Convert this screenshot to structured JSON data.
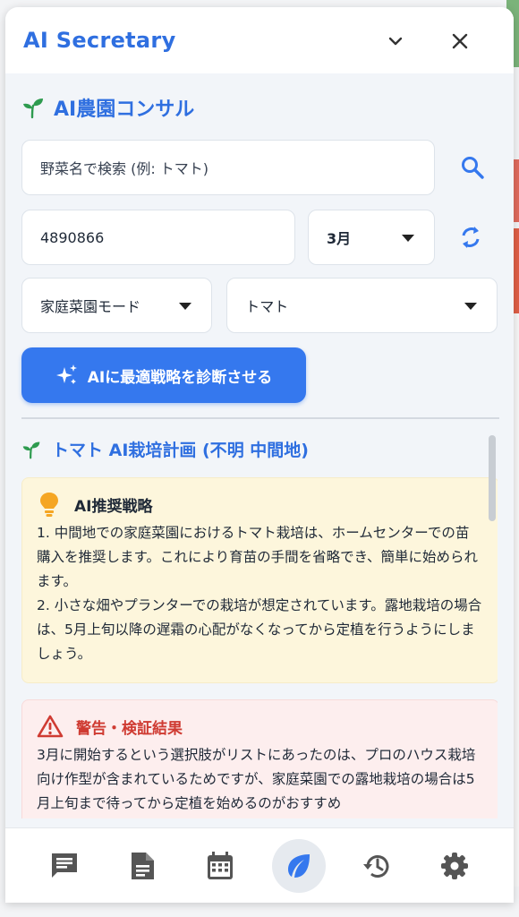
{
  "header": {
    "title": "AI Secretary"
  },
  "consult": {
    "title": "AI農園コンサル",
    "search_placeholder": "野菜名で検索 (例: トマト)",
    "postal_code": "4890866",
    "month": "3月",
    "mode": "家庭菜園モード",
    "crop": "トマト",
    "diagnose_label": "AIに最適戦略を診断させる"
  },
  "plan": {
    "title": "トマト AI栽培計画 (不明 中間地)",
    "strategy": {
      "title": "AI推奨戦略",
      "lines": [
        "1. 中間地での家庭菜園におけるトマト栽培は、ホームセンターでの苗購入を推奨します。これにより育苗の手間を省略でき、簡単に始められます。",
        "2. 小さな畑やプランターでの栽培が想定されています。露地栽培の場合は、5月上旬以降の遅霜の心配がなくなってから定植を行うようにしましょう。"
      ]
    },
    "warning": {
      "title": "警告・検証結果",
      "text": "3月に開始するという選択肢がリストにあったのは、プロのハウス栽培向け作型が含まれているためですが、家庭菜園での露地栽培の場合は5月上旬まで待ってから定植を始めるのがおすすめ"
    }
  },
  "colors": {
    "accent": "#2f6fe0",
    "button": "#3578ee",
    "warning": "#cf3b32",
    "leaf": "#2e9b4f"
  },
  "nav": {
    "items": [
      "chat-icon",
      "document-icon",
      "calendar-icon",
      "leaf-icon",
      "history-icon",
      "settings-icon"
    ],
    "active": "leaf-icon"
  }
}
